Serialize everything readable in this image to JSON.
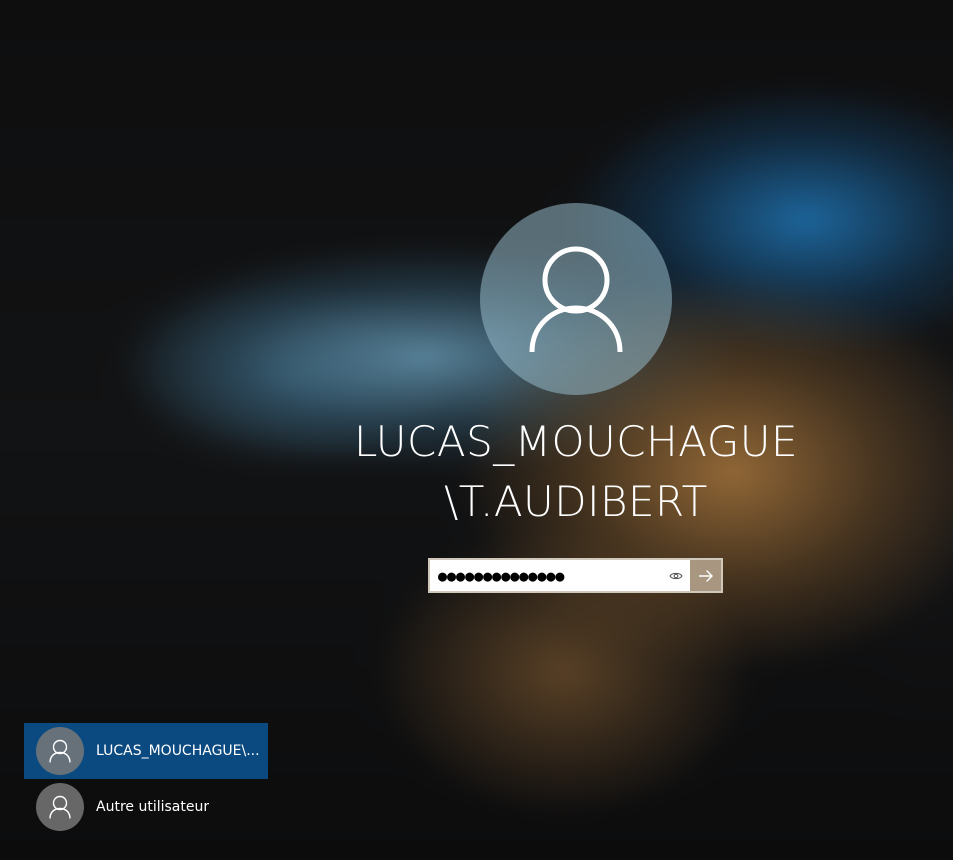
{
  "login": {
    "username_line1": "LUCAS_MOUCHAGUE",
    "username_line2": "\\T.AUDIBERT",
    "password_value": "●●●●●●●●●●●●●●",
    "avatar_icon": "user-icon",
    "reveal_icon": "eye-icon",
    "submit_icon": "arrow-right-icon"
  },
  "user_list": {
    "items": [
      {
        "label": "LUCAS_MOUCHAGUE\\...",
        "icon": "user-icon",
        "selected": true
      },
      {
        "label": "Autre utilisateur",
        "icon": "user-icon",
        "selected": false
      }
    ]
  },
  "colors": {
    "selected_user_bg": "#0b4a80",
    "submit_button_bg": "#8c7355"
  }
}
